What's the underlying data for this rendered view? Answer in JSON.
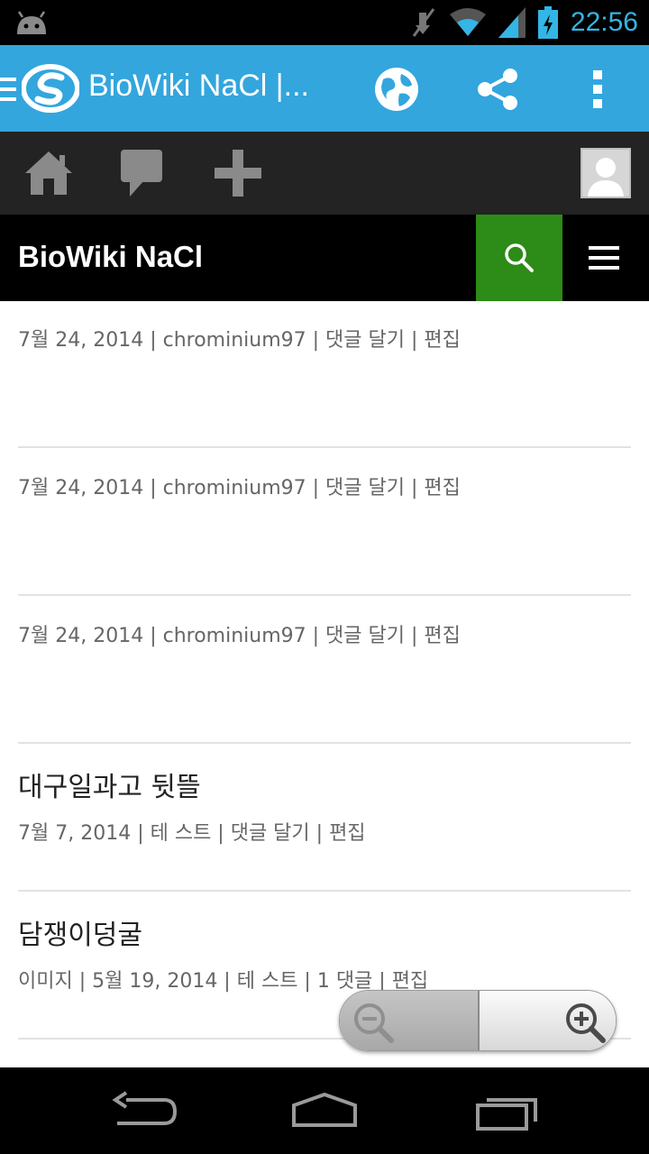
{
  "status_bar": {
    "time": "22:56",
    "icons": [
      "android-debug-icon",
      "mute-icon",
      "wifi-icon",
      "signal-icon",
      "battery-charging-icon"
    ]
  },
  "app_bar": {
    "title": "BioWiki NaCl |...",
    "icons": [
      "drawer-icon",
      "app-logo-icon",
      "globe-icon",
      "share-icon",
      "overflow-menu-icon"
    ],
    "accent": "#33a6dd"
  },
  "wp_toolbar": {
    "icons": [
      "home-icon",
      "comment-icon",
      "plus-icon",
      "avatar-icon"
    ]
  },
  "site_header": {
    "title": "BioWiki NaCl",
    "search_color": "#2d8b17",
    "icons": [
      "search-icon",
      "hamburger-menu-icon"
    ]
  },
  "posts": [
    {
      "title": "",
      "meta": "7월 24, 2014 | chrominium97 | 댓글 달기 | 편집"
    },
    {
      "title": "",
      "meta": "7월 24, 2014 | chrominium97 | 댓글 달기 | 편집"
    },
    {
      "title": "",
      "meta": "7월 24, 2014 | chrominium97 | 댓글 달기 | 편집"
    },
    {
      "title": "대구일과고 뒷뜰",
      "meta": "7월 7, 2014 | 테 스트 | 댓글 달기 | 편집"
    },
    {
      "title": "담쟁이덩굴",
      "meta": "이미지 | 5월 19, 2014 | 테 스트 | 1 댓글 | 편집"
    }
  ],
  "zoom_controls": {
    "icons": [
      "zoom-out-icon",
      "zoom-in-icon"
    ]
  },
  "nav_bar": {
    "icons": [
      "back-icon",
      "home-nav-icon",
      "recent-apps-icon"
    ]
  }
}
